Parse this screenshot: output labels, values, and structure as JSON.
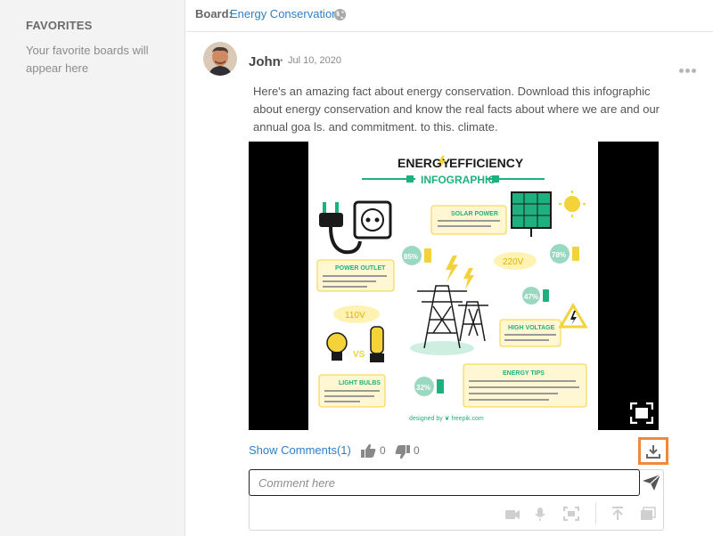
{
  "sidebar": {
    "favorites_title": "FAVORITES",
    "favorites_empty": "Your favorite boards will appear here"
  },
  "board": {
    "label": "Board:",
    "name": "Energy Conservation",
    "icon": "globe-icon"
  },
  "post": {
    "author": "John",
    "separator": "•",
    "date": "Jul 10, 2020",
    "text": "Here's an amazing fact about energy conservation. Download this infographic about energy conservation and know the real facts about where we are and our annual goa ls. and commitment. to this. climate.",
    "image": {
      "title_line1": "ENERGY",
      "title_line1b": "EFFICIENCY",
      "title_line2": "INFOGRAPHIC",
      "solar": "SOLAR POWER",
      "outlet": "POWER OUTLET",
      "voltage_high": "HIGH VOLTAGE",
      "bulbs": "LIGHT BULBS",
      "tips": "ENERGY TIPS",
      "v220": "220V",
      "v110": "110V",
      "vs": "VS",
      "p85": "85%",
      "p78": "78%",
      "p47": "47%",
      "p32": "32%",
      "credit": "designed by ❦ freepik.com"
    }
  },
  "actions": {
    "show_comments": "Show Comments(1)",
    "likes": "0",
    "dislikes": "0"
  },
  "comment": {
    "placeholder": "Comment here"
  },
  "colors": {
    "link": "#2f7ec8",
    "accent_orange": "#f0893a",
    "infographic_green": "#1fb07f",
    "infographic_yellow": "#f3d23a"
  }
}
